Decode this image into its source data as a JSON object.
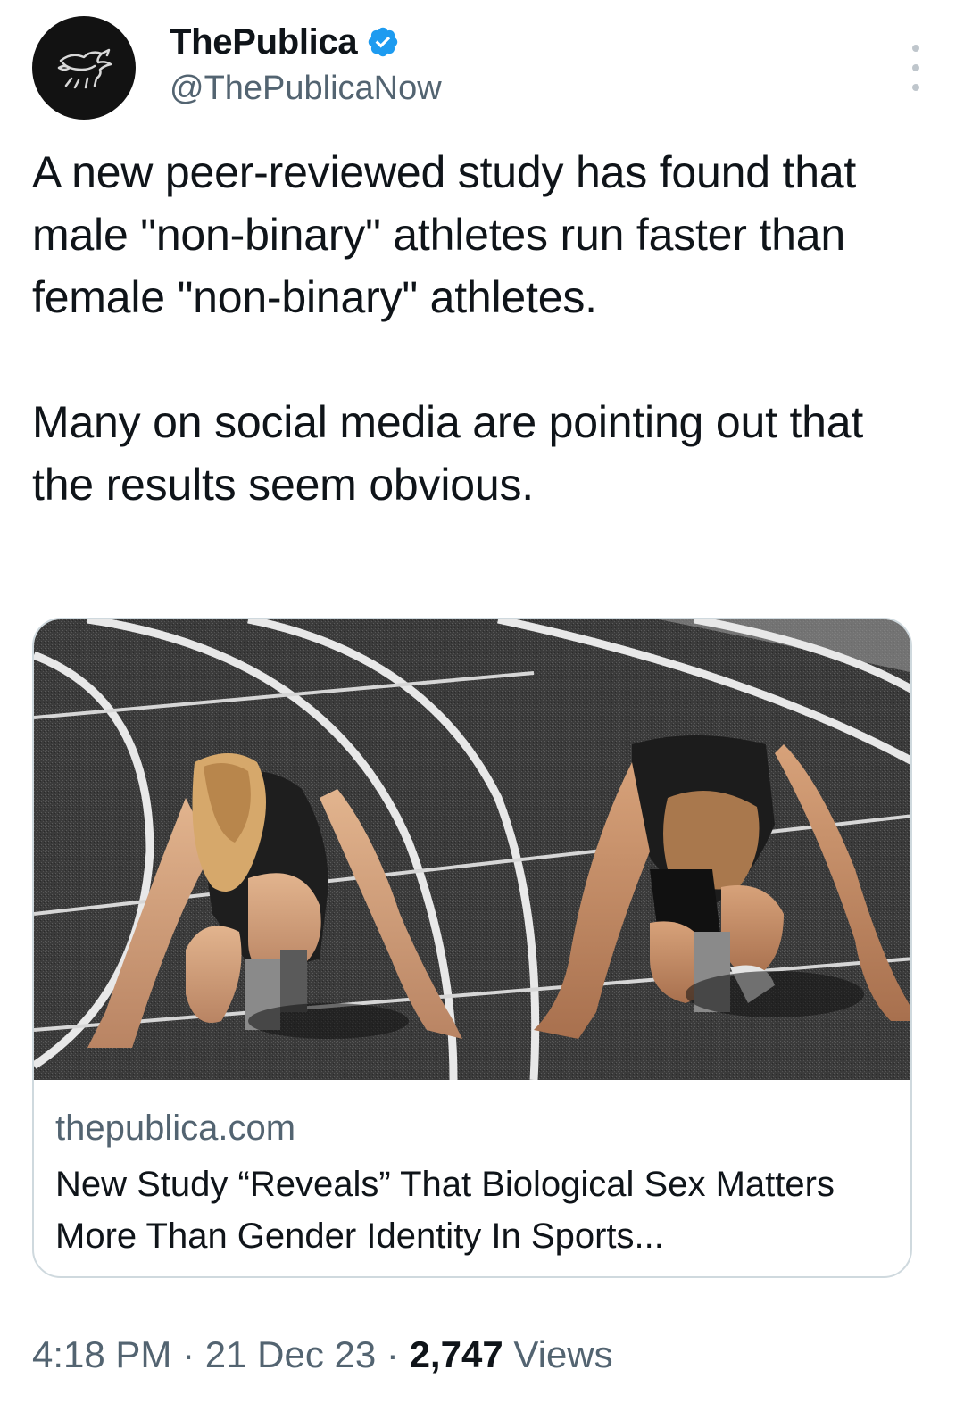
{
  "author": {
    "display_name": "ThePublica",
    "handle": "@ThePublicaNow",
    "verified": true,
    "avatar_icon": "winged-lion-logo"
  },
  "tweet": {
    "paragraphs": [
      "A new peer-reviewed study has found that male \"non-binary\" athletes run faster than female \"non-binary\" athletes.",
      "Many on social media are pointing out that the results seem obvious."
    ]
  },
  "card": {
    "domain": "thepublica.com",
    "title": "New Study “Reveals” That Biological Sex Matters More Than Gender Identity In Sports..."
  },
  "meta": {
    "time": "4:18 PM",
    "separator": "·",
    "date": "21 Dec 23",
    "views_count": "2,747",
    "views_label": "Views"
  },
  "colors": {
    "verified_badge": "#1d9bf0",
    "secondary_text": "#536471",
    "primary_text": "#0f1419",
    "card_border": "#cfd9de"
  }
}
